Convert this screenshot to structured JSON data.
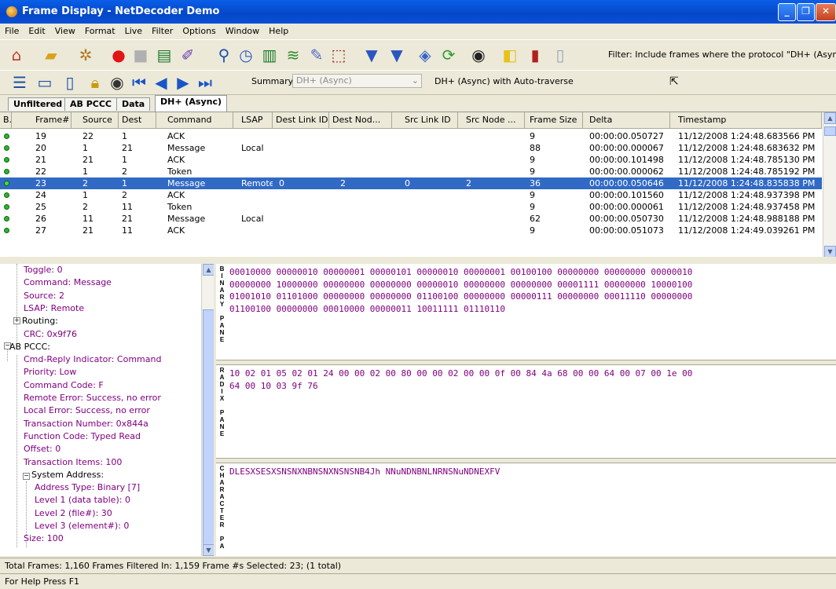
{
  "window": {
    "title": "Frame Display - NetDecoder Demo",
    "minimize": "_",
    "maximize": "❐",
    "close": "✕"
  },
  "menu": [
    "File",
    "Edit",
    "View",
    "Format",
    "Live",
    "Filter",
    "Options",
    "Window",
    "Help"
  ],
  "toolbar": {
    "filter_text": "Filter:  Include frames where the protocol \"DH+ (Async)\" e",
    "summary_label": "Summary",
    "summary_select": "DH+ (Async)",
    "traverse_label": "DH+ (Async) with Auto-traverse"
  },
  "tabs": [
    "Unfiltered",
    "AB PCCC",
    "Data",
    "DH+ (Async)"
  ],
  "columns": [
    "B...",
    "Frame#",
    "Source",
    "Dest",
    "Command",
    "LSAP",
    "Dest Link ID",
    "Dest Nod...",
    "Src Link ID",
    "Src Node ...",
    "Frame Size",
    "Delta",
    "Timestamp"
  ],
  "rows": [
    [
      "19",
      "22",
      "1",
      "ACK",
      "",
      "",
      "",
      "",
      "",
      "9",
      "00:00:00.050727",
      "11/12/2008 1:24:48.683566 PM"
    ],
    [
      "20",
      "1",
      "21",
      "Message",
      "Local",
      "",
      "",
      "",
      "",
      "88",
      "00:00:00.000067",
      "11/12/2008 1:24:48.683632 PM"
    ],
    [
      "21",
      "21",
      "1",
      "ACK",
      "",
      "",
      "",
      "",
      "",
      "9",
      "00:00:00.101498",
      "11/12/2008 1:24:48.785130 PM"
    ],
    [
      "22",
      "1",
      "2",
      "Token",
      "",
      "",
      "",
      "",
      "",
      "9",
      "00:00:00.000062",
      "11/12/2008 1:24:48.785192 PM"
    ],
    [
      "23",
      "2",
      "1",
      "Message",
      "Remote",
      "0",
      "2",
      "0",
      "2",
      "36",
      "00:00:00.050646",
      "11/12/2008 1:24:48.835838 PM"
    ],
    [
      "24",
      "1",
      "2",
      "ACK",
      "",
      "",
      "",
      "",
      "",
      "9",
      "00:00:00.101560",
      "11/12/2008 1:24:48.937398 PM"
    ],
    [
      "25",
      "2",
      "11",
      "Token",
      "",
      "",
      "",
      "",
      "",
      "9",
      "00:00:00.000061",
      "11/12/2008 1:24:48.937458 PM"
    ],
    [
      "26",
      "11",
      "21",
      "Message",
      "Local",
      "",
      "",
      "",
      "",
      "62",
      "00:00:00.050730",
      "11/12/2008 1:24:48.988188 PM"
    ],
    [
      "27",
      "21",
      "11",
      "ACK",
      "",
      "",
      "",
      "",
      "",
      "9",
      "00:00:00.051073",
      "11/12/2008 1:24:49.039261 PM"
    ]
  ],
  "selected_row": "23",
  "tree": [
    "Toggle: 0",
    "Command: Message",
    "Source: 2",
    "LSAP: Remote",
    "Routing:",
    "CRC: 0x9f76",
    "AB PCCC:",
    "Cmd-Reply Indicator: Command",
    "Priority: Low",
    "Command Code: F",
    "Remote Error: Success, no error",
    "Local Error: Success, no error",
    "Transaction Number: 0x844a",
    "Function Code: Typed Read",
    "Offset: 0",
    "Transaction Items: 100",
    "System Address:",
    "Address Type: Binary [7]",
    "Level 1 (data table): 0",
    "Level 2 (file#): 30",
    "Level 3 (element#): 0",
    "Size: 100"
  ],
  "panes": {
    "binary_label": "BINARY PANE",
    "binary_lines": [
      "00010000 00000010 00000001 00000101 00000010 00000001 00100100 00000000 00000000 00000010",
      "00000000 10000000 00000000 00000000 00000010 00000000 00000000 00001111 00000000 10000100",
      "01001010 01101000 00000000 00000000 01100100 00000000 00000111 00000000 00011110 00000000",
      "01100100 00000000 00010000 00000011 10011111 01110110"
    ],
    "radix_label": "RADIX PANE",
    "radix_lines": [
      "10 02 01 05 02 01 24 00 00 02 00 80 00 00 02 00 00 0f 00 84 4a 68 00 00 64 00 07 00 1e 00",
      "64 00 10 03 9f 76"
    ],
    "char_label": "CHARACTER PA",
    "char_line": "DLESXSESXSNSNXNBNSNXNSNSNB4Jh NNuNDNBNLNRNSNuNDNEXFV"
  },
  "status": {
    "totals": "Total Frames:  1,160   Frames Filtered In:  1,159   Frame #s Selected:  23; (1 total)",
    "help": "For Help Press F1"
  }
}
